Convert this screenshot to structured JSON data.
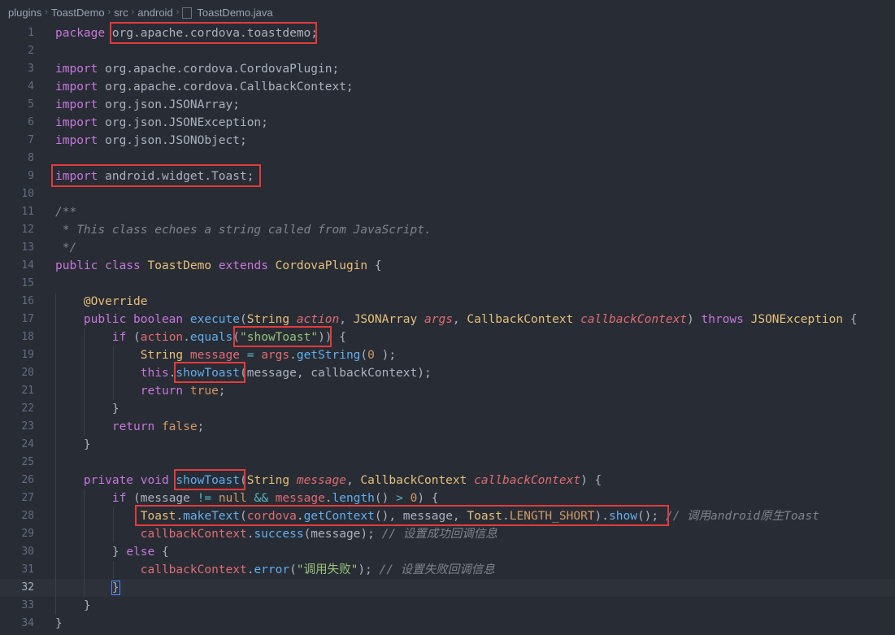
{
  "breadcrumb": [
    "plugins",
    "ToastDemo",
    "src",
    "android",
    "ToastDemo.java"
  ],
  "lines": [
    [
      [
        "k",
        "package "
      ],
      [
        "",
        "org.apache.cordova.toastdemo;"
      ]
    ],
    [],
    [
      [
        "k",
        "import "
      ],
      [
        "",
        "org.apache.cordova.CordovaPlugin;"
      ]
    ],
    [
      [
        "k",
        "import "
      ],
      [
        "",
        "org.apache.cordova.CallbackContext;"
      ]
    ],
    [
      [
        "k",
        "import "
      ],
      [
        "",
        "org.json.JSONArray;"
      ]
    ],
    [
      [
        "k",
        "import "
      ],
      [
        "",
        "org.json.JSONException;"
      ]
    ],
    [
      [
        "k",
        "import "
      ],
      [
        "",
        "org.json.JSONObject;"
      ]
    ],
    [],
    [
      [
        "k",
        "import "
      ],
      [
        "",
        "android.widget.Toast;"
      ]
    ],
    [],
    [
      [
        "c",
        "/**"
      ]
    ],
    [
      [
        "c",
        " * This class echoes a string called from JavaScript."
      ]
    ],
    [
      [
        "c",
        " */"
      ]
    ],
    [
      [
        "k",
        "public class "
      ],
      [
        "t",
        "ToastDemo "
      ],
      [
        "k",
        "extends "
      ],
      [
        "t",
        "CordovaPlugin "
      ],
      [
        "",
        "{"
      ]
    ],
    [],
    [
      [
        "",
        "    "
      ],
      [
        "a",
        "@Override"
      ]
    ],
    [
      [
        "",
        "    "
      ],
      [
        "k",
        "public boolean "
      ],
      [
        "f",
        "execute"
      ],
      [
        "",
        "("
      ],
      [
        "t",
        "String "
      ],
      [
        "p",
        "action"
      ],
      [
        "",
        ", "
      ],
      [
        "t",
        "JSONArray "
      ],
      [
        "p",
        "args"
      ],
      [
        "",
        ", "
      ],
      [
        "t",
        "CallbackContext "
      ],
      [
        "p",
        "callbackContext"
      ],
      [
        "",
        ") "
      ],
      [
        "k",
        "throws "
      ],
      [
        "t",
        "JSONException "
      ],
      [
        "",
        "{"
      ]
    ],
    [
      [
        "",
        "        "
      ],
      [
        "k",
        "if "
      ],
      [
        "",
        "("
      ],
      [
        "v",
        "action"
      ],
      [
        "",
        "."
      ],
      [
        "f",
        "equals"
      ],
      [
        "",
        "("
      ],
      [
        "s",
        "\"showToast\""
      ],
      [
        "",
        ")) {"
      ]
    ],
    [
      [
        "",
        "            "
      ],
      [
        "t",
        "String "
      ],
      [
        "v",
        "message "
      ],
      [
        "o",
        "= "
      ],
      [
        "v",
        "args"
      ],
      [
        "",
        "."
      ],
      [
        "f",
        "getString"
      ],
      [
        "",
        "("
      ],
      [
        "n",
        "0"
      ],
      [
        "",
        " );"
      ]
    ],
    [
      [
        "",
        "            "
      ],
      [
        "k",
        "this"
      ],
      [
        "",
        "."
      ],
      [
        "f",
        "showToast"
      ],
      [
        "",
        "(message, callbackContext);"
      ]
    ],
    [
      [
        "",
        "            "
      ],
      [
        "k",
        "return "
      ],
      [
        "n",
        "true"
      ],
      [
        "",
        ";"
      ]
    ],
    [
      [
        "",
        "        }"
      ]
    ],
    [
      [
        "",
        "        "
      ],
      [
        "k",
        "return "
      ],
      [
        "n",
        "false"
      ],
      [
        "",
        ";"
      ]
    ],
    [
      [
        "",
        "    }"
      ]
    ],
    [],
    [
      [
        "",
        "    "
      ],
      [
        "k",
        "private void "
      ],
      [
        "f",
        "showToast"
      ],
      [
        "",
        "("
      ],
      [
        "t",
        "String "
      ],
      [
        "p",
        "message"
      ],
      [
        "",
        ", "
      ],
      [
        "t",
        "CallbackContext "
      ],
      [
        "p",
        "callbackContext"
      ],
      [
        "",
        ") {"
      ]
    ],
    [
      [
        "",
        "        "
      ],
      [
        "k",
        "if "
      ],
      [
        "",
        "(message "
      ],
      [
        "o",
        "!= "
      ],
      [
        "n",
        "null "
      ],
      [
        "o",
        "&& "
      ],
      [
        "v",
        "message"
      ],
      [
        "",
        "."
      ],
      [
        "f",
        "length"
      ],
      [
        "",
        "() "
      ],
      [
        "o",
        "> "
      ],
      [
        "n",
        "0"
      ],
      [
        "",
        ") {"
      ]
    ],
    [
      [
        "",
        "            "
      ],
      [
        "t",
        "Toast"
      ],
      [
        "",
        "."
      ],
      [
        "f",
        "makeText"
      ],
      [
        "",
        "("
      ],
      [
        "v",
        "cordova"
      ],
      [
        "",
        "."
      ],
      [
        "f",
        "getContext"
      ],
      [
        "",
        "(), message, "
      ],
      [
        "t",
        "Toast"
      ],
      [
        "",
        "."
      ],
      [
        "n",
        "LENGTH_SHORT"
      ],
      [
        "",
        ")."
      ],
      [
        "f",
        "show"
      ],
      [
        "",
        "(); "
      ],
      [
        "c",
        "// 调用android原生Toast"
      ]
    ],
    [
      [
        "",
        "            "
      ],
      [
        "v",
        "callbackContext"
      ],
      [
        "",
        "."
      ],
      [
        "f",
        "success"
      ],
      [
        "",
        "(message); "
      ],
      [
        "c",
        "// 设置成功回调信息"
      ]
    ],
    [
      [
        "",
        "        } "
      ],
      [
        "k",
        "else "
      ],
      [
        "",
        "{"
      ]
    ],
    [
      [
        "",
        "            "
      ],
      [
        "v",
        "callbackContext"
      ],
      [
        "",
        "."
      ],
      [
        "f",
        "error"
      ],
      [
        "",
        "("
      ],
      [
        "s",
        "\"调用失败\""
      ],
      [
        "",
        "); "
      ],
      [
        "c",
        "// 设置失败回调信息"
      ]
    ],
    [
      [
        "",
        "        }"
      ]
    ],
    [
      [
        "",
        "    }"
      ]
    ],
    [
      [
        "",
        "}"
      ]
    ]
  ],
  "current_line": 32,
  "colors": {
    "background": "#282c34",
    "keyword": "#c678dd",
    "type": "#e5c07b",
    "function": "#61afef",
    "string": "#98c379",
    "highlight_box": "#e03c3c"
  }
}
